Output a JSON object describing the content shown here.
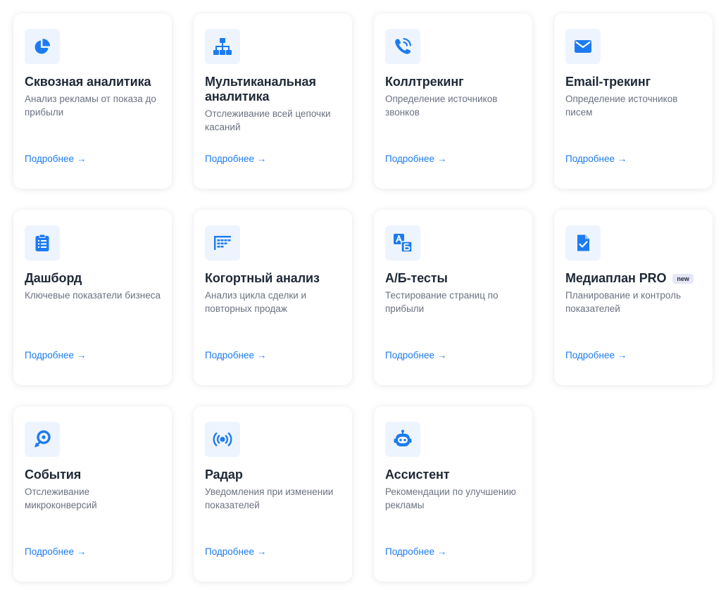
{
  "colors": {
    "accent": "#1d7bf0",
    "icon_bg": "#eef4fd",
    "title": "#1f2937",
    "description": "#6b7280",
    "badge_bg": "#e5e7f8"
  },
  "cards": [
    {
      "icon": "pie-chart-icon",
      "title": "Сквозная аналитика",
      "badge": "",
      "description": "Анализ рекламы от показа до прибыли",
      "link": "Подробнее →"
    },
    {
      "icon": "hierarchy-icon",
      "title": "Мультиканальная аналитика",
      "badge": "",
      "description": "Отслеживание всей цепочки касаний",
      "link": "Подробнее →"
    },
    {
      "icon": "phone-call-icon",
      "title": "Коллтрекинг",
      "badge": "",
      "description": "Определение источников звонков",
      "link": "Подробнее →"
    },
    {
      "icon": "envelope-icon",
      "title": "Email-трекинг",
      "badge": "",
      "description": "Определение источников писем",
      "link": "Подробнее →"
    },
    {
      "icon": "clipboard-list-icon",
      "title": "Дашборд",
      "badge": "",
      "description": "Ключевые показатели бизнеса",
      "link": "Подробнее →"
    },
    {
      "icon": "cohort-table-icon",
      "title": "Когортный анализ",
      "badge": "",
      "description": "Анализ цикла сделки и повторных продаж",
      "link": "Подробнее →"
    },
    {
      "icon": "ab-test-icon",
      "title": "А/Б-тесты",
      "badge": "",
      "description": "Тестирование страниц по прибыли",
      "link": "Подробнее →"
    },
    {
      "icon": "document-check-icon",
      "title": "Медиаплан PRO",
      "badge": "new",
      "description": "Планирование и контроль показателей",
      "link": "Подробнее →"
    },
    {
      "icon": "target-cursor-icon",
      "title": "События",
      "badge": "",
      "description": "Отслеживание микроконверсий",
      "link": "Подробнее →"
    },
    {
      "icon": "radar-broadcast-icon",
      "title": "Радар",
      "badge": "",
      "description": "Уведомления при изменении показателей",
      "link": "Подробнее →"
    },
    {
      "icon": "robot-icon",
      "title": "Ассистент",
      "badge": "",
      "description": "Рекомендации по улучшению рекламы",
      "link": "Подробнее →"
    }
  ]
}
